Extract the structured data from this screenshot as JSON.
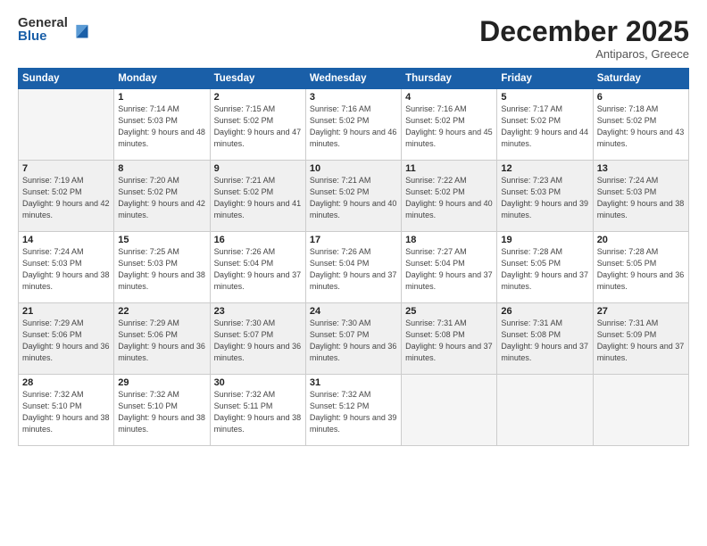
{
  "logo": {
    "general": "General",
    "blue": "Blue"
  },
  "title": "December 2025",
  "subtitle": "Antiparos, Greece",
  "days_header": [
    "Sunday",
    "Monday",
    "Tuesday",
    "Wednesday",
    "Thursday",
    "Friday",
    "Saturday"
  ],
  "weeks": [
    [
      {
        "num": "",
        "empty": true
      },
      {
        "num": "1",
        "sunrise": "Sunrise: 7:14 AM",
        "sunset": "Sunset: 5:03 PM",
        "daylight": "Daylight: 9 hours and 48 minutes."
      },
      {
        "num": "2",
        "sunrise": "Sunrise: 7:15 AM",
        "sunset": "Sunset: 5:02 PM",
        "daylight": "Daylight: 9 hours and 47 minutes."
      },
      {
        "num": "3",
        "sunrise": "Sunrise: 7:16 AM",
        "sunset": "Sunset: 5:02 PM",
        "daylight": "Daylight: 9 hours and 46 minutes."
      },
      {
        "num": "4",
        "sunrise": "Sunrise: 7:16 AM",
        "sunset": "Sunset: 5:02 PM",
        "daylight": "Daylight: 9 hours and 45 minutes."
      },
      {
        "num": "5",
        "sunrise": "Sunrise: 7:17 AM",
        "sunset": "Sunset: 5:02 PM",
        "daylight": "Daylight: 9 hours and 44 minutes."
      },
      {
        "num": "6",
        "sunrise": "Sunrise: 7:18 AM",
        "sunset": "Sunset: 5:02 PM",
        "daylight": "Daylight: 9 hours and 43 minutes."
      }
    ],
    [
      {
        "num": "7",
        "sunrise": "Sunrise: 7:19 AM",
        "sunset": "Sunset: 5:02 PM",
        "daylight": "Daylight: 9 hours and 42 minutes."
      },
      {
        "num": "8",
        "sunrise": "Sunrise: 7:20 AM",
        "sunset": "Sunset: 5:02 PM",
        "daylight": "Daylight: 9 hours and 42 minutes."
      },
      {
        "num": "9",
        "sunrise": "Sunrise: 7:21 AM",
        "sunset": "Sunset: 5:02 PM",
        "daylight": "Daylight: 9 hours and 41 minutes."
      },
      {
        "num": "10",
        "sunrise": "Sunrise: 7:21 AM",
        "sunset": "Sunset: 5:02 PM",
        "daylight": "Daylight: 9 hours and 40 minutes."
      },
      {
        "num": "11",
        "sunrise": "Sunrise: 7:22 AM",
        "sunset": "Sunset: 5:02 PM",
        "daylight": "Daylight: 9 hours and 40 minutes."
      },
      {
        "num": "12",
        "sunrise": "Sunrise: 7:23 AM",
        "sunset": "Sunset: 5:03 PM",
        "daylight": "Daylight: 9 hours and 39 minutes."
      },
      {
        "num": "13",
        "sunrise": "Sunrise: 7:24 AM",
        "sunset": "Sunset: 5:03 PM",
        "daylight": "Daylight: 9 hours and 38 minutes."
      }
    ],
    [
      {
        "num": "14",
        "sunrise": "Sunrise: 7:24 AM",
        "sunset": "Sunset: 5:03 PM",
        "daylight": "Daylight: 9 hours and 38 minutes."
      },
      {
        "num": "15",
        "sunrise": "Sunrise: 7:25 AM",
        "sunset": "Sunset: 5:03 PM",
        "daylight": "Daylight: 9 hours and 38 minutes."
      },
      {
        "num": "16",
        "sunrise": "Sunrise: 7:26 AM",
        "sunset": "Sunset: 5:04 PM",
        "daylight": "Daylight: 9 hours and 37 minutes."
      },
      {
        "num": "17",
        "sunrise": "Sunrise: 7:26 AM",
        "sunset": "Sunset: 5:04 PM",
        "daylight": "Daylight: 9 hours and 37 minutes."
      },
      {
        "num": "18",
        "sunrise": "Sunrise: 7:27 AM",
        "sunset": "Sunset: 5:04 PM",
        "daylight": "Daylight: 9 hours and 37 minutes."
      },
      {
        "num": "19",
        "sunrise": "Sunrise: 7:28 AM",
        "sunset": "Sunset: 5:05 PM",
        "daylight": "Daylight: 9 hours and 37 minutes."
      },
      {
        "num": "20",
        "sunrise": "Sunrise: 7:28 AM",
        "sunset": "Sunset: 5:05 PM",
        "daylight": "Daylight: 9 hours and 36 minutes."
      }
    ],
    [
      {
        "num": "21",
        "sunrise": "Sunrise: 7:29 AM",
        "sunset": "Sunset: 5:06 PM",
        "daylight": "Daylight: 9 hours and 36 minutes."
      },
      {
        "num": "22",
        "sunrise": "Sunrise: 7:29 AM",
        "sunset": "Sunset: 5:06 PM",
        "daylight": "Daylight: 9 hours and 36 minutes."
      },
      {
        "num": "23",
        "sunrise": "Sunrise: 7:30 AM",
        "sunset": "Sunset: 5:07 PM",
        "daylight": "Daylight: 9 hours and 36 minutes."
      },
      {
        "num": "24",
        "sunrise": "Sunrise: 7:30 AM",
        "sunset": "Sunset: 5:07 PM",
        "daylight": "Daylight: 9 hours and 36 minutes."
      },
      {
        "num": "25",
        "sunrise": "Sunrise: 7:31 AM",
        "sunset": "Sunset: 5:08 PM",
        "daylight": "Daylight: 9 hours and 37 minutes."
      },
      {
        "num": "26",
        "sunrise": "Sunrise: 7:31 AM",
        "sunset": "Sunset: 5:08 PM",
        "daylight": "Daylight: 9 hours and 37 minutes."
      },
      {
        "num": "27",
        "sunrise": "Sunrise: 7:31 AM",
        "sunset": "Sunset: 5:09 PM",
        "daylight": "Daylight: 9 hours and 37 minutes."
      }
    ],
    [
      {
        "num": "28",
        "sunrise": "Sunrise: 7:32 AM",
        "sunset": "Sunset: 5:10 PM",
        "daylight": "Daylight: 9 hours and 38 minutes."
      },
      {
        "num": "29",
        "sunrise": "Sunrise: 7:32 AM",
        "sunset": "Sunset: 5:10 PM",
        "daylight": "Daylight: 9 hours and 38 minutes."
      },
      {
        "num": "30",
        "sunrise": "Sunrise: 7:32 AM",
        "sunset": "Sunset: 5:11 PM",
        "daylight": "Daylight: 9 hours and 38 minutes."
      },
      {
        "num": "31",
        "sunrise": "Sunrise: 7:32 AM",
        "sunset": "Sunset: 5:12 PM",
        "daylight": "Daylight: 9 hours and 39 minutes."
      },
      {
        "num": "",
        "empty": true
      },
      {
        "num": "",
        "empty": true
      },
      {
        "num": "",
        "empty": true
      }
    ]
  ]
}
